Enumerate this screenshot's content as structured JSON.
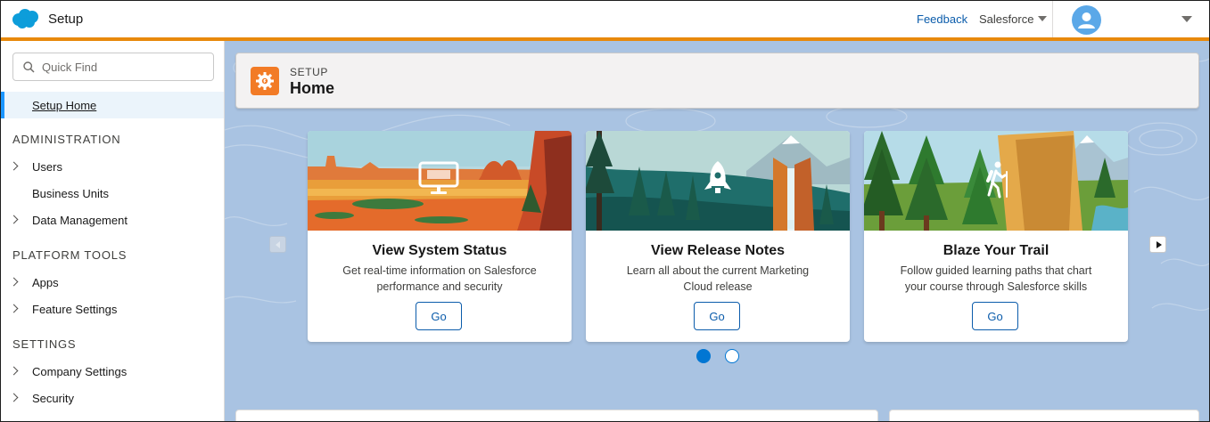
{
  "header": {
    "app_title": "Setup",
    "feedback_label": "Feedback",
    "org_label": "Salesforce"
  },
  "sidebar": {
    "quick_find_placeholder": "Quick Find",
    "setup_home_label": "Setup Home",
    "sections": [
      {
        "title": "ADMINISTRATION",
        "items": [
          {
            "label": "Users",
            "expandable": true
          },
          {
            "label": "Business Units",
            "expandable": false
          },
          {
            "label": "Data Management",
            "expandable": true
          }
        ]
      },
      {
        "title": "PLATFORM TOOLS",
        "items": [
          {
            "label": "Apps",
            "expandable": true
          },
          {
            "label": "Feature Settings",
            "expandable": true
          }
        ]
      },
      {
        "title": "SETTINGS",
        "items": [
          {
            "label": "Company Settings",
            "expandable": true
          },
          {
            "label": "Security",
            "expandable": true
          }
        ]
      }
    ]
  },
  "page_header": {
    "eyebrow": "SETUP",
    "title": "Home"
  },
  "cards": [
    {
      "title": "View System Status",
      "description": "Get real-time information on Salesforce performance and security",
      "button_label": "Go",
      "icon": "monitor-icon"
    },
    {
      "title": "View Release Notes",
      "description": "Learn all about the current Marketing Cloud release",
      "button_label": "Go",
      "icon": "rocket-icon"
    },
    {
      "title": "Blaze Your Trail",
      "description": "Follow guided learning paths that chart your course through Salesforce skills",
      "button_label": "Go",
      "icon": "hiker-icon"
    }
  ],
  "carousel": {
    "current_page": 1,
    "total_pages": 2
  },
  "colors": {
    "accent": "#e8890c",
    "brand_blue": "#0176d3",
    "link_blue": "#0b5cab",
    "background": "#a9c3e2",
    "setup_icon": "#f27b26"
  }
}
